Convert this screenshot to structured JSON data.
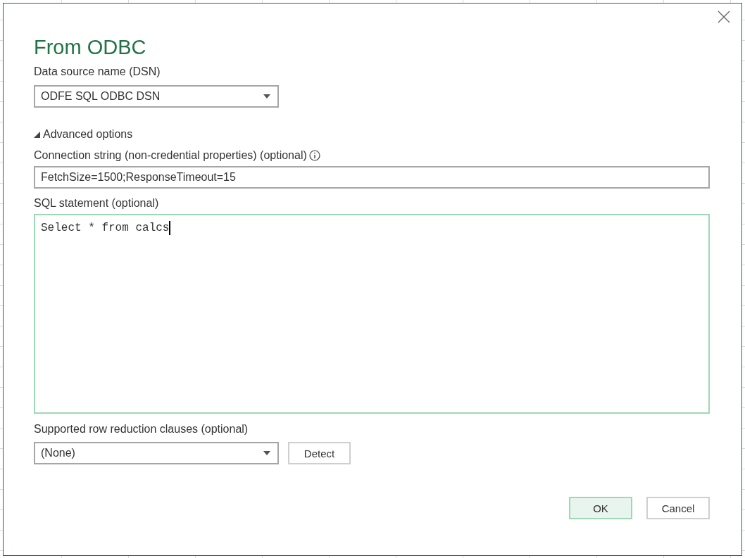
{
  "dialog": {
    "title": "From ODBC",
    "dsn": {
      "label": "Data source name (DSN)",
      "value": "ODFE SQL ODBC DSN"
    },
    "advanced_options": {
      "label": "Advanced options",
      "expanded": true,
      "connection_string": {
        "label": "Connection string (non-credential properties) (optional)",
        "value": "FetchSize=1500;ResponseTimeout=15"
      },
      "sql_statement": {
        "label": "SQL statement (optional)",
        "value": "Select * from calcs"
      },
      "row_reduction": {
        "label": "Supported row reduction clauses (optional)",
        "value": "(None)",
        "button": "Detect"
      }
    },
    "buttons": [
      {
        "label": "OK",
        "kind": "primary"
      },
      {
        "label": "Cancel",
        "kind": "secondary"
      }
    ]
  }
}
